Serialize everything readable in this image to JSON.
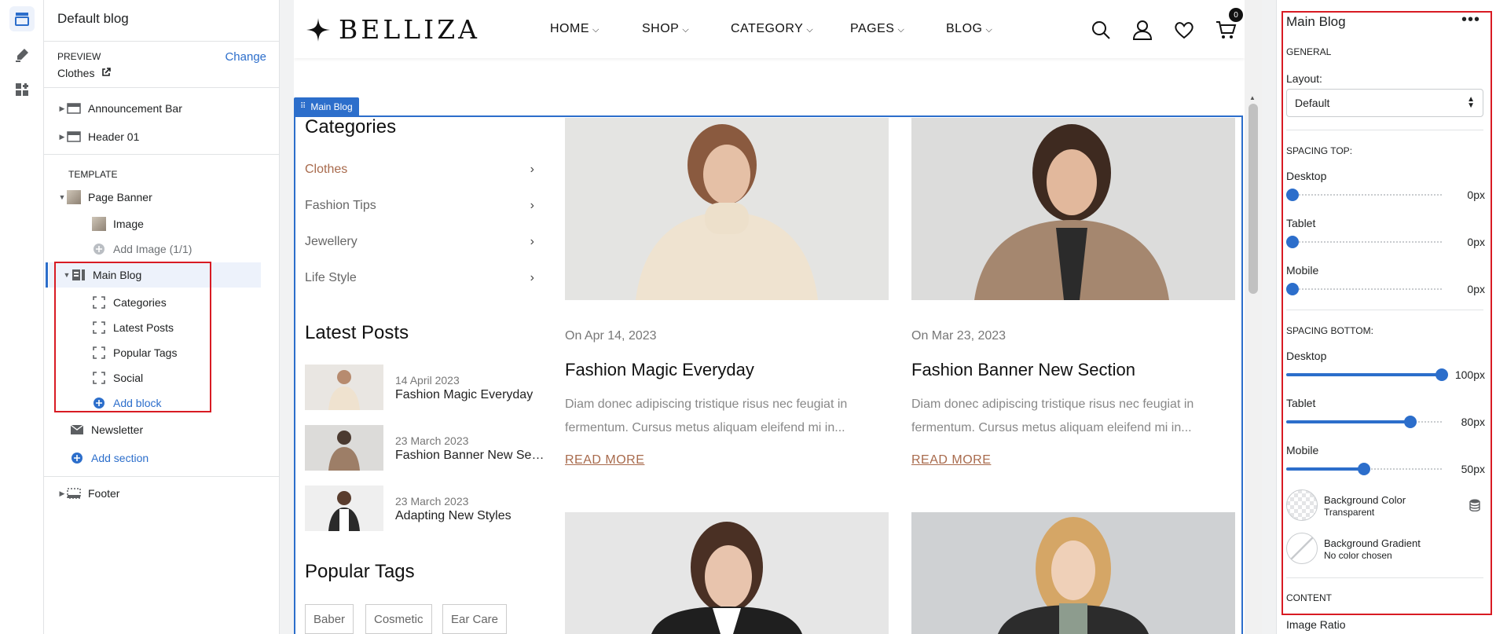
{
  "rail": {
    "icons": [
      "sections-icon",
      "theme-settings-icon",
      "apps-icon"
    ]
  },
  "sidebar": {
    "title": "Default blog",
    "preview": {
      "label": "PREVIEW",
      "change": "Change",
      "value": "Clothes"
    },
    "header_items": [
      {
        "label": "Announcement Bar"
      },
      {
        "label": "Header 01"
      }
    ],
    "template_label": "TEMPLATE",
    "page_banner": {
      "label": "Page Banner",
      "children": [
        {
          "label": "Image"
        }
      ],
      "add": "Add Image (1/1)"
    },
    "main_blog": {
      "label": "Main Blog",
      "blocks": [
        {
          "label": "Categories"
        },
        {
          "label": "Latest Posts"
        },
        {
          "label": "Popular Tags"
        },
        {
          "label": "Social"
        }
      ],
      "add_block": "Add block"
    },
    "newsletter": "Newsletter",
    "add_section": "Add section",
    "footer": "Footer"
  },
  "store": {
    "logo": "BELLIZA",
    "nav": [
      "HOME",
      "SHOP",
      "CATEGORY",
      "PAGES",
      "BLOG"
    ],
    "cart_count": "0",
    "section_tag": "Main Blog",
    "categories_heading": "Categories",
    "categories": [
      "Clothes",
      "Fashion Tips",
      "Jewellery",
      "Life Style"
    ],
    "latest_heading": "Latest Posts",
    "latest": [
      {
        "date": "14 April 2023",
        "title": "Fashion Magic Everyday"
      },
      {
        "date": "23 March 2023",
        "title": "Fashion Banner New Sec..."
      },
      {
        "date": "23 March 2023",
        "title": "Adapting New Styles"
      }
    ],
    "tags_heading": "Popular Tags",
    "tags": [
      "Baber",
      "Cosmetic",
      "Ear Care"
    ],
    "posts": [
      {
        "date": "On Apr 14, 2023",
        "title": "Fashion Magic Everyday",
        "excerpt": "Diam donec adipiscing tristique risus nec feugiat in fermentum. Cursus metus aliquam eleifend mi in...",
        "more": "READ MORE"
      },
      {
        "date": "On Mar 23, 2023",
        "title": "Fashion Banner New Section",
        "excerpt": "Diam donec adipiscing tristique risus nec feugiat in fermentum. Cursus metus aliquam eleifend mi in...",
        "more": "READ MORE"
      }
    ]
  },
  "panel": {
    "title": "Main Blog",
    "more": "•••",
    "general": "GENERAL",
    "layout_label": "Layout:",
    "layout_value": "Default",
    "spacing_top": "SPACING TOP:",
    "spacing_bottom": "SPACING BOTTOM:",
    "top": [
      {
        "label": "Desktop",
        "value": "0px",
        "fraction": 0
      },
      {
        "label": "Tablet",
        "value": "0px",
        "fraction": 0
      },
      {
        "label": "Mobile",
        "value": "0px",
        "fraction": 0
      }
    ],
    "bottom": [
      {
        "label": "Desktop",
        "value": "100px",
        "fraction": 1
      },
      {
        "label": "Tablet",
        "value": "80px",
        "fraction": 0.8
      },
      {
        "label": "Mobile",
        "value": "50px",
        "fraction": 0.5
      }
    ],
    "bg_color": {
      "name": "Background Color",
      "value": "Transparent"
    },
    "bg_gradient": {
      "name": "Background Gradient",
      "value": "No color chosen"
    },
    "content": "CONTENT",
    "image_ratio": "Image Ratio"
  },
  "colors": {
    "accent": "#2c6ecb",
    "highlight": "#d81b23",
    "brand_link": "#a86a4c"
  }
}
